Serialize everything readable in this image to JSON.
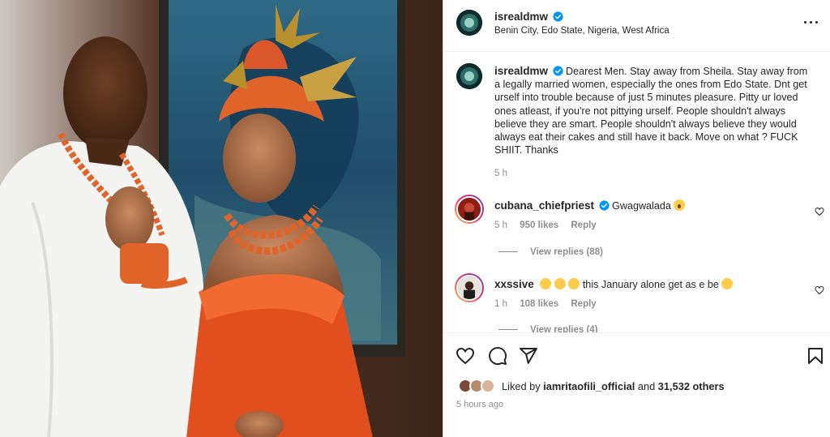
{
  "post": {
    "username": "isrealdmw",
    "location": "Benin City, Edo State, Nigeria, West Africa",
    "caption": "Dearest Men. Stay away from Sheila. Stay away from a legally married women, especially the ones from Edo State. Dnt get urself into trouble because of just 5 minutes pleasure. Pitty ur loved ones atleast, if you're not pittying urself. People shouldn't always believe they are smart. People shouldn't always believe they would always eat their cakes and still have it back. Move on what ? FUCK SHIIT. Thanks",
    "caption_time": "5 h"
  },
  "comments": [
    {
      "username": "cubana_chiefpriest",
      "text": "Gwagwalada",
      "time": "5 h",
      "likes": "950 likes",
      "reply": "Reply",
      "view_replies": "View replies (88)"
    },
    {
      "username": "xxssive",
      "text": "this January alone get as e be",
      "time": "1 h",
      "likes": "108 likes",
      "reply": "Reply",
      "view_replies": "View replies (4)"
    }
  ],
  "likes": {
    "prefix": "Liked by",
    "user": "iamritaofili_official",
    "middle": "and",
    "count": "31,532 others"
  },
  "posted": "5 hours ago",
  "icons": {
    "verified": "verified-badge-icon",
    "more": "more-options-icon",
    "like": "heart-icon",
    "comment": "comment-icon",
    "share": "share-icon",
    "save": "bookmark-icon"
  },
  "colors": {
    "verified": "#0095f6",
    "text": "#262626",
    "muted": "#8e8e8e",
    "coral": "#e8622a"
  }
}
